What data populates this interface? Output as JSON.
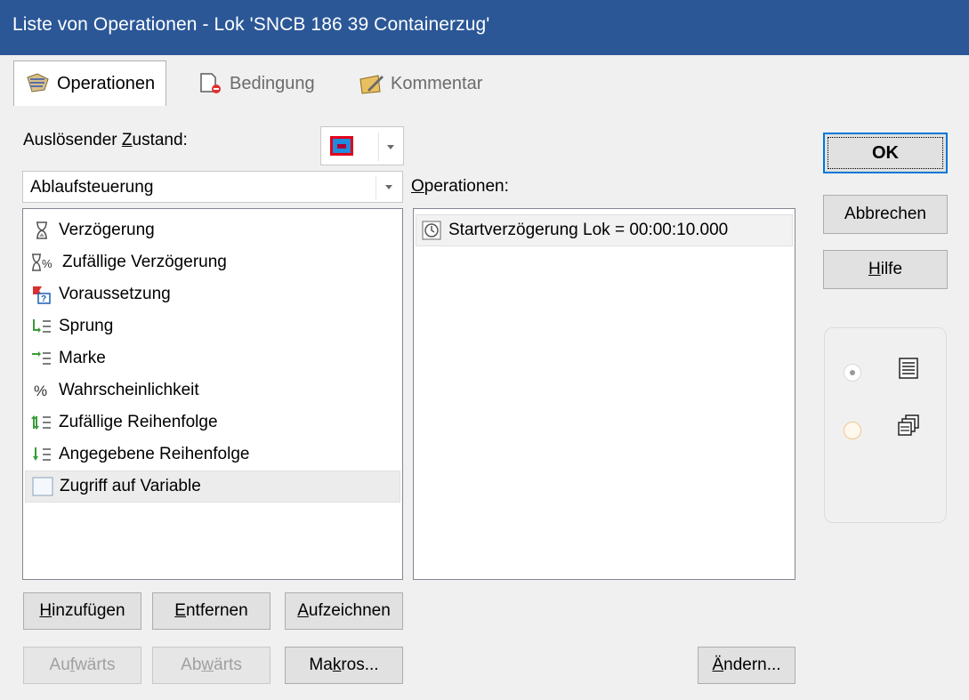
{
  "window": {
    "title": "Liste von Operationen - Lok 'SNCB 186 39 Containerzug'"
  },
  "tabs": [
    {
      "label": "Operationen",
      "icon": "operations-hand-icon",
      "active": true
    },
    {
      "label": "Bedingung",
      "icon": "condition-icon",
      "active": false
    },
    {
      "label": "Kommentar",
      "icon": "comment-pencil-icon",
      "active": false
    }
  ],
  "trigger": {
    "label_pre": "Auslösender ",
    "label_u": "Z",
    "label_post": "ustand:",
    "swatch_color": "#1e8ddb"
  },
  "category": {
    "selected": "Ablaufsteuerung"
  },
  "available_operations": [
    {
      "icon": "hourglass-icon",
      "glyph": "⌛",
      "label": "Verzögerung"
    },
    {
      "icon": "random-delay-icon",
      "glyph": "⌛%",
      "label": "Zufällige Verzögerung"
    },
    {
      "icon": "precondition-flag-icon",
      "glyph": "⚑?",
      "label": "Voraussetzung"
    },
    {
      "icon": "jump-icon",
      "glyph": "↳≡",
      "label": "Sprung"
    },
    {
      "icon": "mark-icon",
      "glyph": "→≡",
      "label": "Marke"
    },
    {
      "icon": "percent-icon",
      "glyph": "%",
      "label": "Wahrscheinlichkeit"
    },
    {
      "icon": "random-order-icon",
      "glyph": "⇅≡",
      "label": "Zufällige Reihenfolge"
    },
    {
      "icon": "given-order-icon",
      "glyph": "↓≡",
      "label": "Angegebene Reihenfolge"
    },
    {
      "icon": "variable-access-icon",
      "glyph": "",
      "label": "Zugriff auf Variable"
    }
  ],
  "operations": {
    "label_u": "O",
    "label_rest": "perationen:",
    "items": [
      {
        "icon": "clock-icon",
        "label": "Startverzögerung Lok = 00:00:10.000"
      }
    ]
  },
  "buttons": {
    "add": {
      "u": "H",
      "rest": "inzufügen"
    },
    "remove": {
      "pre": "",
      "u": "E",
      "rest": "ntfernen"
    },
    "record": {
      "u": "A",
      "rest": "ufzeichnen"
    },
    "up": {
      "pre": "Au",
      "u": "f",
      "rest": "wärts"
    },
    "down": {
      "pre": "Ab",
      "u": "w",
      "rest": "ärts"
    },
    "macros": {
      "pre": "Ma",
      "u": "k",
      "rest": "ros..."
    },
    "change": {
      "u": "Ä",
      "rest": "ndern..."
    },
    "ok": "OK",
    "cancel": "Abbrechen",
    "help": {
      "u": "H",
      "rest": "ilfe"
    }
  },
  "view_options": [
    {
      "icon": "list-view-icon",
      "checked": true
    },
    {
      "icon": "cascade-view-icon",
      "checked": false
    }
  ]
}
